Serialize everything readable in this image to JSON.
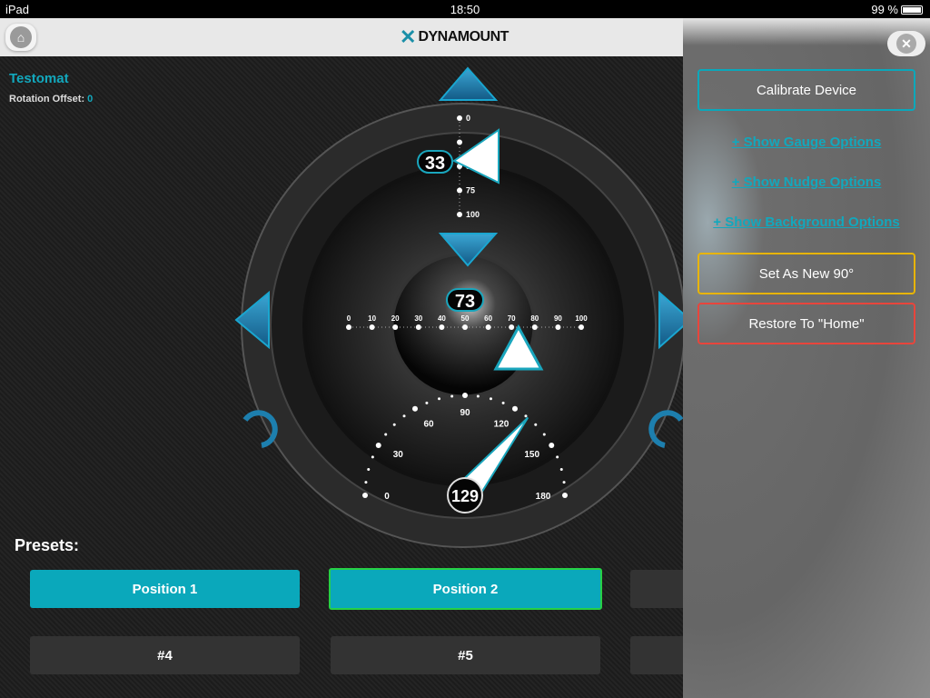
{
  "status": {
    "device": "iPad",
    "time": "18:50",
    "battery": "99 %",
    "battery_level": 0.99
  },
  "header": {
    "logo": "DYNAMOUNT"
  },
  "device": {
    "name": "Testomat",
    "offset_label": "Rotation Offset:",
    "offset_value": "0"
  },
  "gauges": {
    "vertical": {
      "value": 33,
      "labels": [
        "0",
        "50",
        "75",
        "100"
      ],
      "ticks": [
        0,
        25,
        50,
        75,
        100
      ],
      "display": "33"
    },
    "horizontal": {
      "value": 73,
      "labels": [
        "0",
        "10",
        "20",
        "30",
        "40",
        "50",
        "60",
        "70",
        "80",
        "90",
        "100"
      ],
      "display": "73"
    },
    "rotation": {
      "value": 129,
      "labels": [
        "0",
        "30",
        "60",
        "90",
        "120",
        "150",
        "180"
      ],
      "display": "129"
    }
  },
  "presets": {
    "label": "Presets:",
    "items": [
      {
        "label": "Position 1"
      },
      {
        "label": "Position 2"
      },
      {
        "label": ""
      },
      {
        "label": "#4"
      },
      {
        "label": "#5"
      },
      {
        "label": ""
      }
    ]
  },
  "panel": {
    "calibrate": "Calibrate Device",
    "gauge_opts": "+ Show Gauge Options",
    "nudge_opts": "+ Show Nudge Options",
    "bg_opts": "+ Show Background Options",
    "set90": "Set As New 90°",
    "restore": "Restore To \"Home\""
  },
  "colors": {
    "accent": "#0aa8bb",
    "selected": "#26d046",
    "warning": "#e8b400",
    "danger": "#e8453c"
  }
}
